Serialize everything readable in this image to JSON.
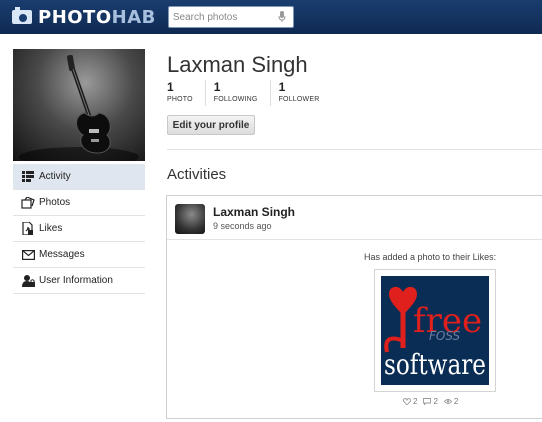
{
  "header": {
    "logo_main": "PHOTO",
    "logo_accent": "HAB",
    "search_placeholder": "Search photos"
  },
  "profile": {
    "name": "Laxman Singh",
    "stats": [
      {
        "value": "1",
        "label": "PHOTO"
      },
      {
        "value": "1",
        "label": "FOLLOWING"
      },
      {
        "value": "1",
        "label": "FOLLOWER"
      }
    ],
    "edit_label": "Edit your profile"
  },
  "sidebar": {
    "items": [
      {
        "label": "Activity",
        "icon": "activity-list-icon",
        "active": true
      },
      {
        "label": "Photos",
        "icon": "photos-icon",
        "active": false
      },
      {
        "label": "Likes",
        "icon": "likes-icon",
        "active": false
      },
      {
        "label": "Messages",
        "icon": "envelope-icon",
        "active": false
      },
      {
        "label": "User Information",
        "icon": "user-lock-icon",
        "active": false
      }
    ]
  },
  "activities": {
    "title": "Activities",
    "item": {
      "user": "Laxman Singh",
      "time": "9 seconds ago",
      "caption": "Has added a photo to their Likes:",
      "photo_text_top": "free",
      "photo_text_bottom": "software",
      "photo_text_mid": "FOSS",
      "likes": "2",
      "comments": "2",
      "views": "2"
    }
  },
  "colors": {
    "topbar": "#1a3d6f",
    "active_nav": "#dfe6ef",
    "photo_red": "#e0201c",
    "photo_bg": "#0a2d55"
  }
}
